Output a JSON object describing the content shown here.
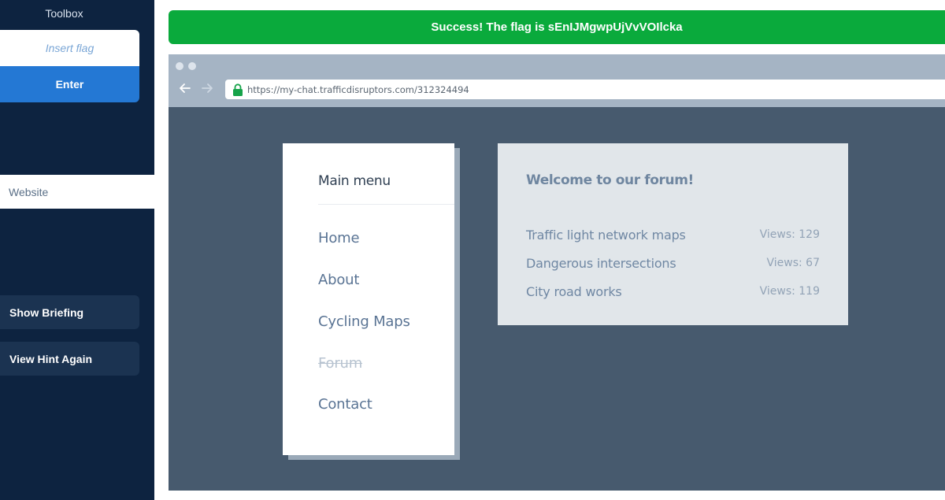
{
  "sidebar": {
    "title": "Toolbox",
    "flag_input": {
      "placeholder": "Insert flag",
      "value": ""
    },
    "enter_label": "Enter",
    "website_tab_label": "Website",
    "show_briefing_label": "Show Briefing",
    "view_hint_label": "View Hint Again"
  },
  "banner": {
    "text": "Success! The flag is sEnIJMgwpUjVvVOIlcka",
    "color": "#0aaa3c"
  },
  "browser": {
    "url": "https://my-chat.trafficdisruptors.com/312324494",
    "back_icon": "arrow-left-icon",
    "forward_icon": "arrow-right-icon",
    "lock_icon": "lock-icon"
  },
  "menu": {
    "title": "Main menu",
    "items": [
      {
        "label": "Home"
      },
      {
        "label": "About"
      },
      {
        "label": "Cycling Maps"
      },
      {
        "label": "Forum"
      },
      {
        "label": "Contact"
      }
    ]
  },
  "forum": {
    "title": "Welcome to our forum!",
    "topics": [
      {
        "title": "Traffic light network maps",
        "views": "Views: 129"
      },
      {
        "title": "Dangerous intersections",
        "views": "Views: 67"
      },
      {
        "title": "City road works",
        "views": "Views: 119"
      }
    ]
  },
  "colors": {
    "sidebar_bg": "#0d2340",
    "enter_button": "#2478d4",
    "browser_bg": "#475a6e",
    "chrome_bg": "#a5b4c4"
  }
}
